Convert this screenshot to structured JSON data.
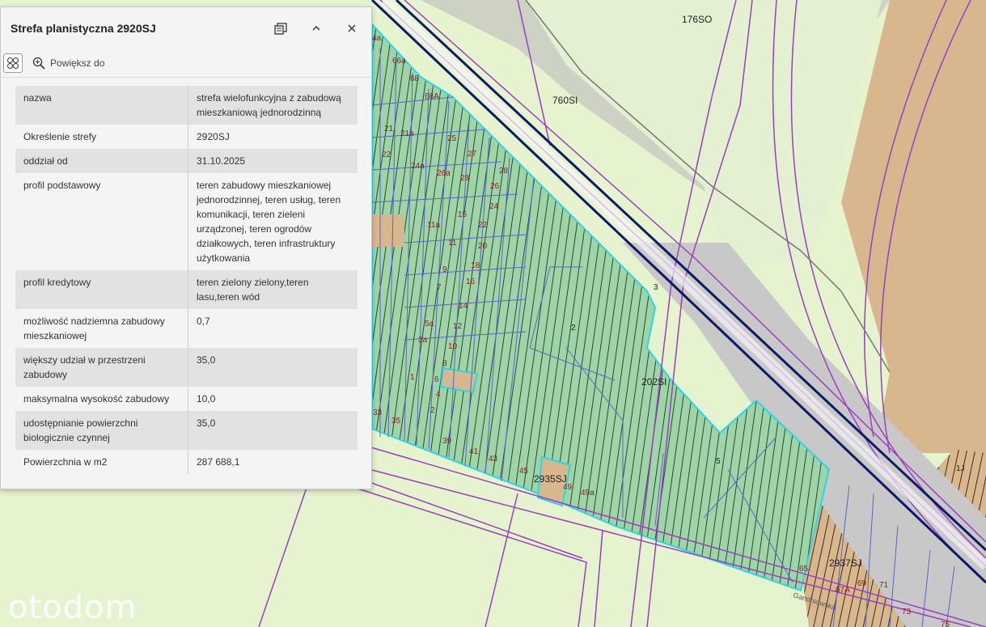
{
  "panel": {
    "title": "Strefa planistyczna 2920SJ",
    "toolbar": {
      "zoom_label": "Powiększ do"
    },
    "rows": [
      {
        "key": "nazwa",
        "value": "strefa wielofunkcyjna z zabudową mieszkaniową jednorodzinną"
      },
      {
        "key": "Określenie strefy",
        "value": "2920SJ"
      },
      {
        "key": "oddział od",
        "value": "31.10.2025"
      },
      {
        "key": "profil podstawowy",
        "value": "teren zabudowy mieszkaniowej jednorodzinnej, teren usług, teren komunikacji, teren zieleni urządzonej, teren ogrodów działkowych, teren infrastruktury użytkowania"
      },
      {
        "key": "profil kredytowy",
        "value": "teren zielony zielony,teren lasu,teren wód"
      },
      {
        "key": "możliwość nadziemna zabudowy mieszkaniowej",
        "value": "0,7"
      },
      {
        "key": "większy udział w przestrzeni zabudowy",
        "value": "35,0"
      },
      {
        "key": "maksymalna wysokość zabudowy",
        "value": "10,0"
      },
      {
        "key": "udostępnianie powierzchni biologicznie czynnej",
        "value": "35,0"
      },
      {
        "key": "Powierzchnia w m2",
        "value": "287 688,1"
      }
    ]
  },
  "map": {
    "zone_labels": {
      "z176so": "176SO",
      "z760si": "760SI",
      "z202si": "202SI",
      "z2935sj": "2935SJ",
      "z2937sj": "2937SJ",
      "z1j": "1J"
    },
    "parcel_labels": [
      "4a",
      "66a",
      "68",
      "68A",
      "21",
      "21a",
      "25",
      "27",
      "22",
      "24a",
      "26a",
      "28",
      "28",
      "26",
      "24",
      "15",
      "22",
      "11a",
      "20",
      "11",
      "18",
      "9",
      "16",
      "7",
      "14",
      "5a",
      "12",
      "3a",
      "10",
      "8",
      "6",
      "1",
      "4",
      "2",
      "33",
      "35",
      "39",
      "41",
      "43",
      "45",
      "49",
      "49a",
      "2",
      "3",
      "5",
      "65",
      "67A",
      "69",
      "71",
      "73",
      "75"
    ],
    "street_label": "Gandhiowska"
  },
  "colors": {
    "zone_green": "#9fd4a9",
    "hatch": "#27492f",
    "parcel_line": "#5a64c8",
    "road_purple": "#9b3fbf",
    "highlight": "#2ad6e8",
    "road_blue": "#0d1a66",
    "tan": "#d8b78e",
    "light_green": "#e6f3cf"
  },
  "watermark": "otodom"
}
